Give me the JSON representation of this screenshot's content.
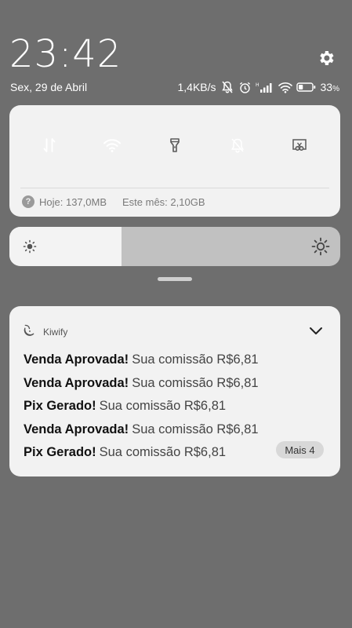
{
  "status": {
    "time": "23:42",
    "date": "Sex, 29 de Abril",
    "net_speed": "1,4KB/s",
    "battery_pct": "33",
    "battery_unit": "%",
    "battery_level": 0.33
  },
  "quick_settings": {
    "toggles": [
      {
        "name": "mobile-data",
        "icon": "data-arrows-icon",
        "active": true
      },
      {
        "name": "wifi",
        "icon": "wifi-icon",
        "active": true
      },
      {
        "name": "flashlight",
        "icon": "flashlight-icon",
        "active": false
      },
      {
        "name": "silent",
        "icon": "bell-off-icon",
        "active": true
      },
      {
        "name": "screenshot",
        "icon": "scissors-screenshot-icon",
        "active": false
      }
    ],
    "help_icon": "?",
    "usage_today": "Hoje: 137,0MB",
    "usage_month": "Este mês: 2,10GB",
    "brightness_level": 0.34,
    "accent_color": "#2196f3"
  },
  "notification": {
    "app_name": "Kiwify",
    "lines": [
      {
        "title": "Venda Aprovada!",
        "body": "Sua comissão R$6,81"
      },
      {
        "title": "Venda Aprovada!",
        "body": "Sua comissão R$6,81"
      },
      {
        "title": "Pix Gerado!",
        "body": "Sua comissão R$6,81"
      },
      {
        "title": "Venda Aprovada!",
        "body": "Sua comissão R$6,81"
      },
      {
        "title": "Pix Gerado!",
        "body": "Sua comissão R$6,81"
      }
    ],
    "more_label": "Mais 4"
  }
}
